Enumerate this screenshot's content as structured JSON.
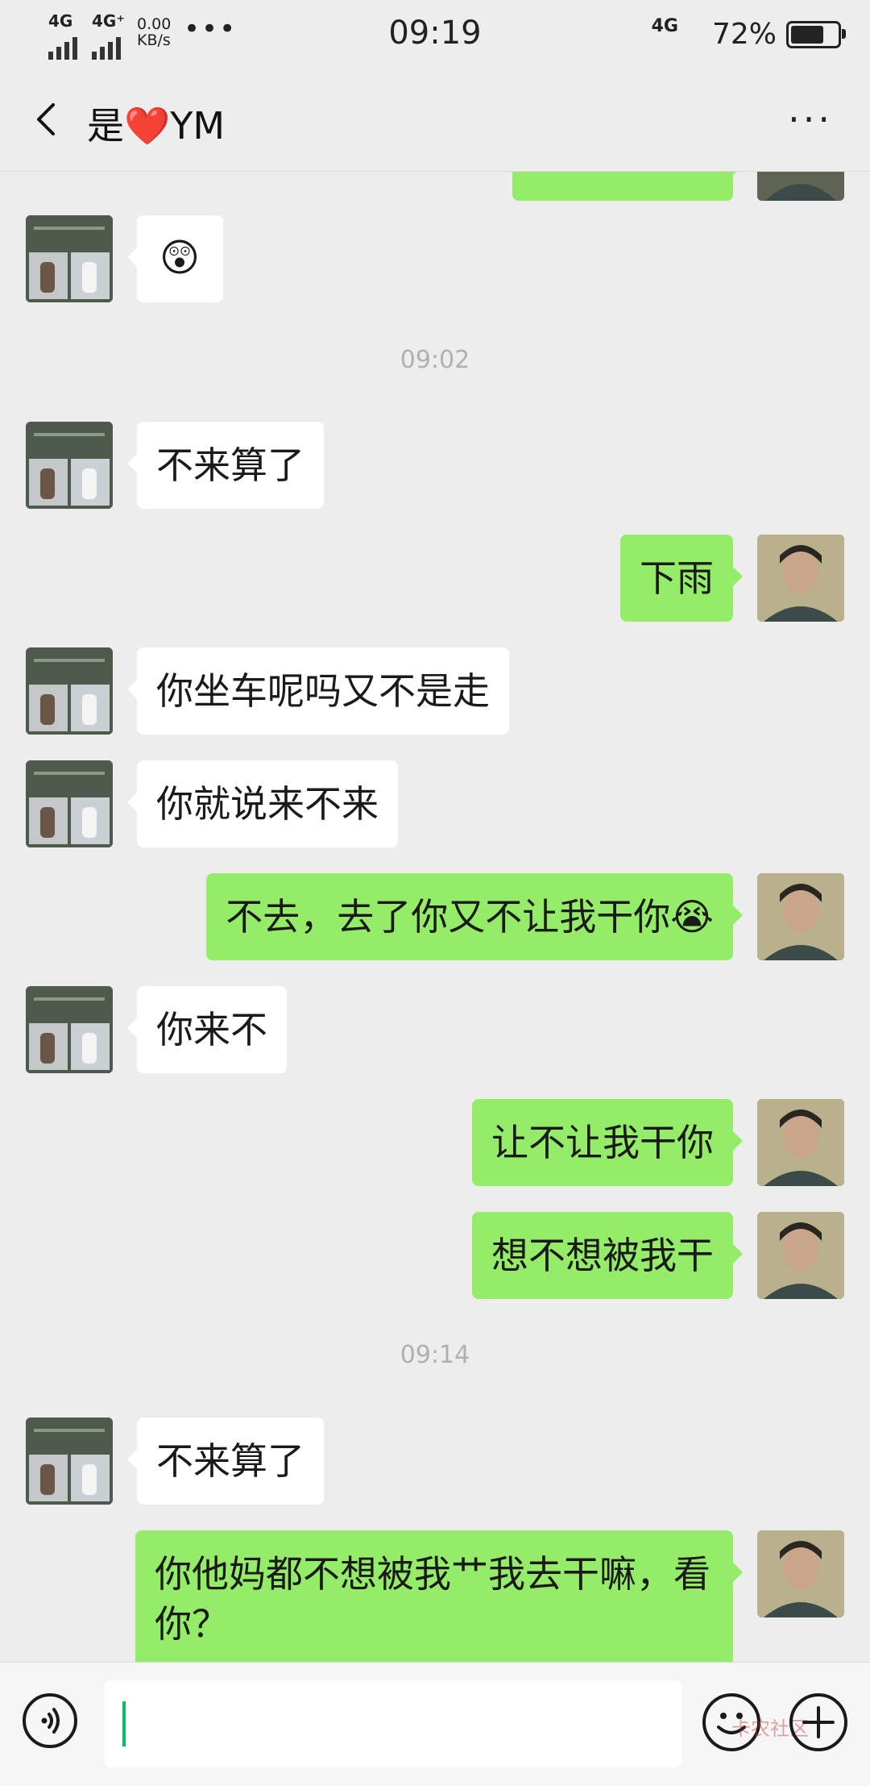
{
  "status_bar": {
    "signal_1": "4G",
    "signal_2": "4G⁺",
    "net_speed_value": "0.00",
    "net_speed_unit": "KB/s",
    "time": "09:19",
    "signal_3": "4G",
    "battery": "72%",
    "battery_level": 0.72
  },
  "header": {
    "title": "是❤️YM",
    "more": "···"
  },
  "messages": [
    {
      "side": "self",
      "text": "",
      "partial": true
    },
    {
      "side": "other",
      "type": "emoji",
      "text": "😲"
    },
    {
      "type": "time",
      "text": "09:02"
    },
    {
      "side": "other",
      "text": "不来算了"
    },
    {
      "side": "self",
      "text": "下雨"
    },
    {
      "side": "other",
      "text": "你坐车呢吗又不是走"
    },
    {
      "side": "other",
      "text": "你就说来不来"
    },
    {
      "side": "self",
      "text": "不去，去了你又不让我干你😭"
    },
    {
      "side": "other",
      "text": "你来不"
    },
    {
      "side": "self",
      "text": "让不让我干你"
    },
    {
      "side": "self",
      "text": "想不想被我干"
    },
    {
      "type": "time",
      "text": "09:14"
    },
    {
      "side": "other",
      "text": "不来算了"
    },
    {
      "side": "self",
      "text": "你他妈都不想被我艹我去干嘛，看你？"
    }
  ],
  "input_bar": {
    "placeholder": "",
    "watermark": "卡农社区"
  },
  "colors": {
    "background": "#ededed",
    "self_bubble": "#95ec69",
    "other_bubble": "#ffffff",
    "cursor": "#07c160"
  }
}
